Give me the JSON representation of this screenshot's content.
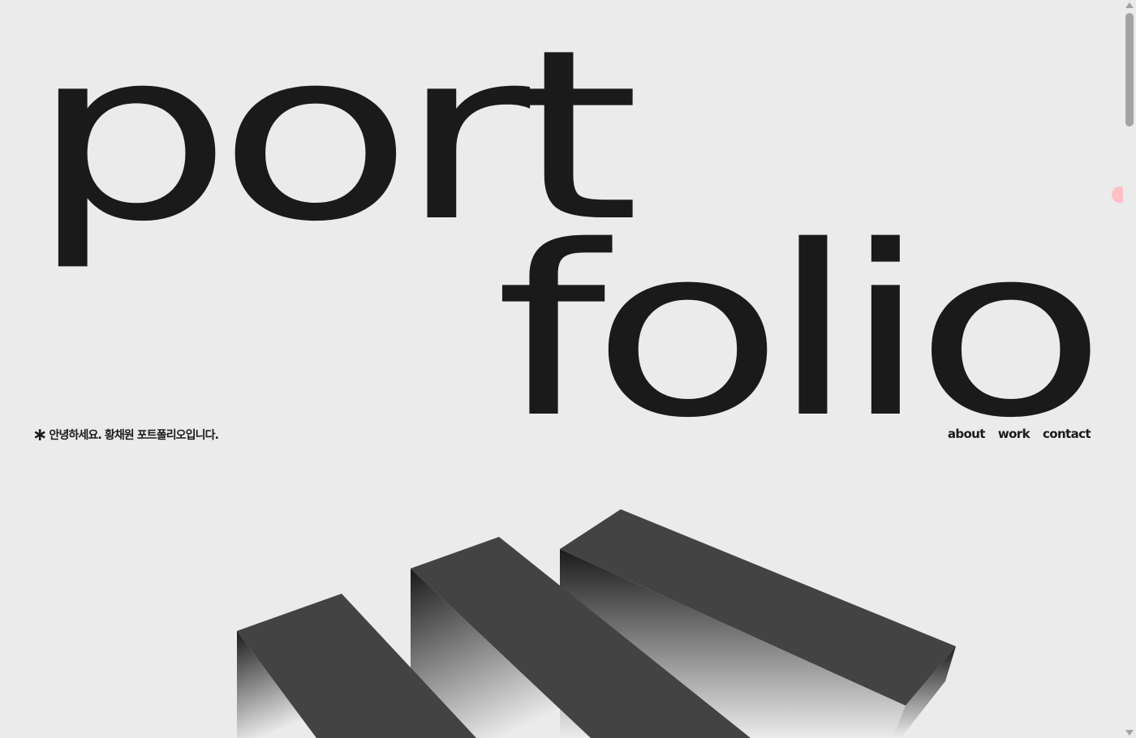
{
  "hero": {
    "word_top": "port",
    "word_bottom": "folio"
  },
  "intro": {
    "marker": "∗",
    "text": "안녕하세요. 황채원 포트폴리오입니다."
  },
  "nav": {
    "about": "about",
    "work": "work",
    "contact": "contact"
  },
  "colors": {
    "background": "#ebebeb",
    "text": "#1a1a1a",
    "block_top": "#434343",
    "accent_dot": "#ffbfc7"
  },
  "icons": {
    "marker": "asterisk-icon"
  }
}
